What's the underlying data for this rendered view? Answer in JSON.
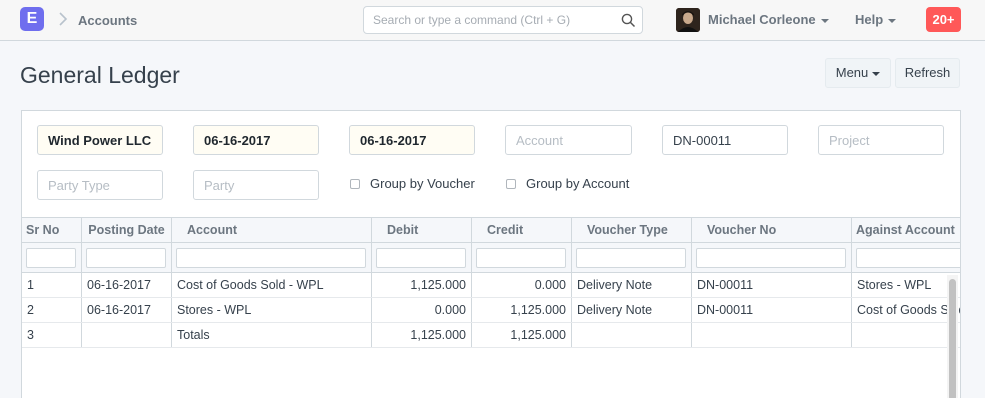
{
  "navbar": {
    "logo_letter": "E",
    "breadcrumb": "Accounts",
    "search_placeholder": "Search or type a command (Ctrl + G)",
    "user_name": "Michael Corleone",
    "help_label": "Help",
    "notifications": "20+"
  },
  "page": {
    "title": "General Ledger",
    "menu_label": "Menu",
    "refresh_label": "Refresh"
  },
  "filters": {
    "company": "Wind Power LLC",
    "from_date": "06-16-2017",
    "to_date": "06-16-2017",
    "account_placeholder": "Account",
    "voucher_no": "DN-00011",
    "project_placeholder": "Project",
    "party_type_placeholder": "Party Type",
    "party_placeholder": "Party",
    "group_by_voucher": "Group by Voucher",
    "group_by_account": "Group by Account"
  },
  "table": {
    "headers": [
      "Sr No",
      "Posting Date",
      "Account",
      "Debit",
      "Credit",
      "Voucher Type",
      "Voucher No",
      "Against Account"
    ],
    "rows": [
      [
        "1",
        "06-16-2017",
        "Cost of Goods Sold - WPL",
        "1,125.000",
        "0.000",
        "Delivery Note",
        "DN-00011",
        "Stores - WPL"
      ],
      [
        "2",
        "06-16-2017",
        "Stores - WPL",
        "0.000",
        "1,125.000",
        "Delivery Note",
        "DN-00011",
        "Cost of Goods Sold - WPL"
      ],
      [
        "3",
        "",
        "Totals",
        "1,125.000",
        "1,125.000",
        "",
        "",
        ""
      ]
    ]
  }
}
